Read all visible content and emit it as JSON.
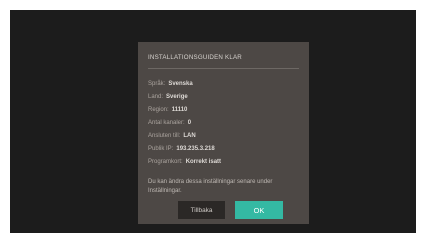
{
  "dialog": {
    "title": "INSTALLATIONSGUIDEN KLAR",
    "rows": [
      {
        "label": "Språk:",
        "value": "Svenska"
      },
      {
        "label": "Land:",
        "value": "Sverige"
      },
      {
        "label": "Region:",
        "value": "11110"
      },
      {
        "label": "Antal kanaler:",
        "value": "0"
      },
      {
        "label": "Ansluten till:",
        "value": "LAN"
      },
      {
        "label": "Publik IP:",
        "value": "193.235.3.218"
      },
      {
        "label": "Programkort:",
        "value": "Korrekt isatt"
      }
    ],
    "note": "Du kan ändra dessa inställningar senare under Inställningar.",
    "back_label": "Tillbaka",
    "ok_label": "OK"
  },
  "colors": {
    "screen_bg": "#1c1c1c",
    "dialog_bg": "#4d4845",
    "accent": "#34b9a3",
    "back_button_bg": "#2b2826"
  }
}
